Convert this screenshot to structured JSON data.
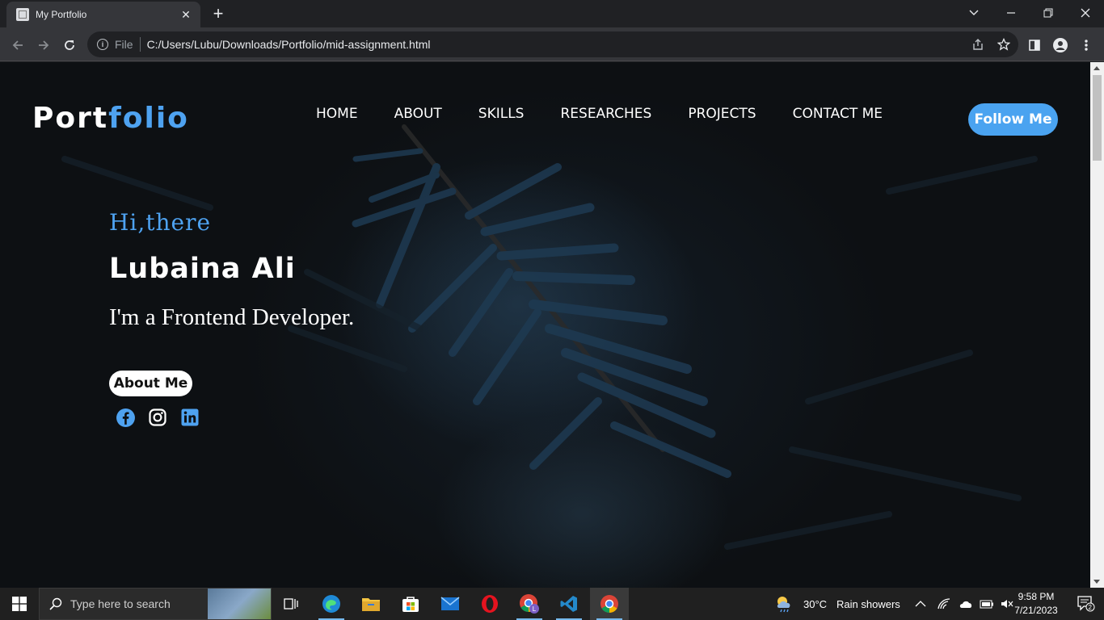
{
  "browser": {
    "tab_title": "My Portfolio",
    "tab_close": "✕",
    "new_tab": "+",
    "omnibox_scheme": "File",
    "omnibox_url": "C:/Users/Lubu/Downloads/Portfolio/mid-assignment.html"
  },
  "site": {
    "logo_part1": "Port",
    "logo_part2": "folio",
    "nav": [
      "HOME",
      "ABOUT",
      "SKILLS",
      "RESEARCHES",
      "PROJECTS",
      "CONTACT ME"
    ],
    "follow_label": "Follow Me",
    "greeting": "Hi,there",
    "name": "Lubaina Ali",
    "role": "I'm a Frontend Developer.",
    "about_label": "About Me",
    "socials": [
      "facebook-icon",
      "instagram-icon",
      "linkedin-icon"
    ],
    "accent_color": "#4ea2f0"
  },
  "taskbar": {
    "search_placeholder": "Type here to search",
    "weather_temp": "30°C",
    "weather_desc": "Rain showers",
    "time": "9:58 PM",
    "date": "7/21/2023",
    "notification_count": "2"
  }
}
